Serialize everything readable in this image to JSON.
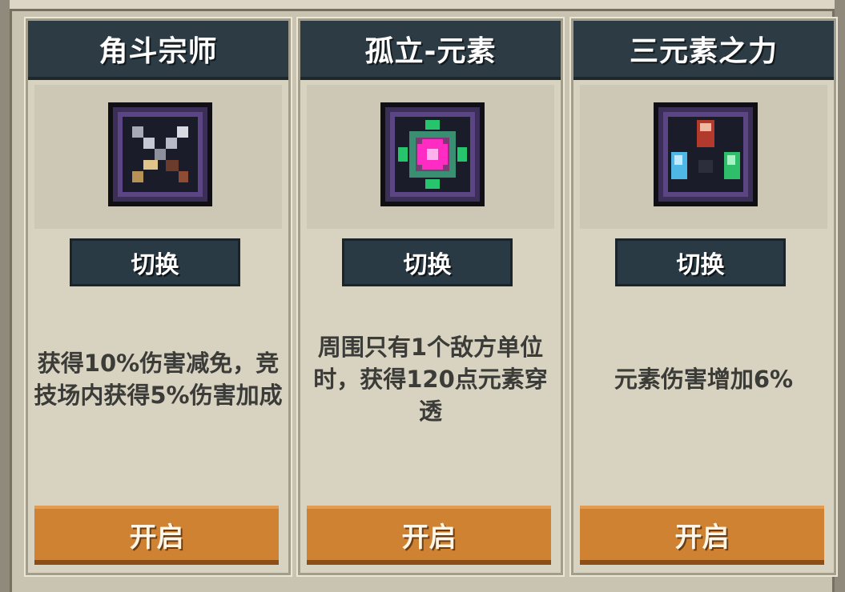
{
  "panel": {
    "colors": {
      "header_bg": "#2c3b44",
      "card_bg": "#d8d2c1",
      "button_dark": "#2a3a45",
      "button_orange": "#cf8232",
      "text_dark": "#3b3b38"
    }
  },
  "cards": [
    {
      "title": "角斗宗师",
      "icon": "crossed-swords-icon",
      "switch_label": "切换",
      "description": "获得10%伤害减免，竞技场内获得5%伤害加成",
      "open_label": "开启"
    },
    {
      "title": "孤立-元素",
      "icon": "element-orb-icon",
      "switch_label": "切换",
      "description": "周围只有1个敌方单位时，获得120点元素穿透",
      "open_label": "开启"
    },
    {
      "title": "三元素之力",
      "icon": "three-elements-icon",
      "switch_label": "切换",
      "description": "元素伤害增加6%",
      "open_label": "开启"
    }
  ]
}
